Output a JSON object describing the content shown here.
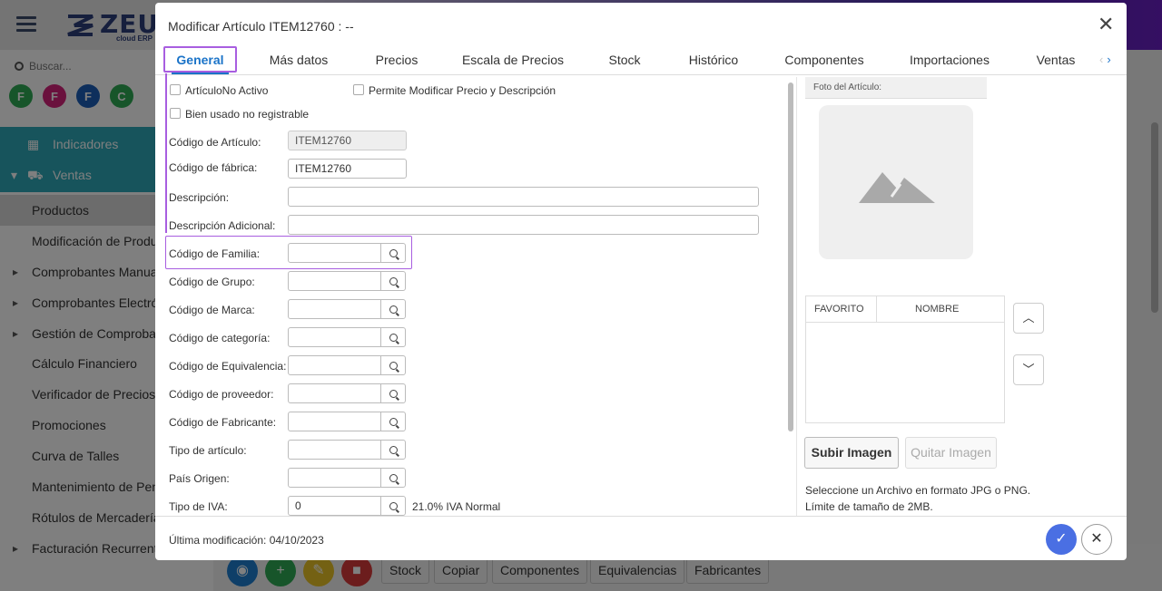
{
  "background": {
    "logo_text": "ZEUS",
    "logo_sub": "cloud ERP",
    "search_placeholder": "Buscar...",
    "avatars": [
      {
        "letter": "F",
        "color": "#2eaa54"
      },
      {
        "letter": "F",
        "color": "#d4237a"
      },
      {
        "letter": "F",
        "color": "#1d5fb8"
      },
      {
        "letter": "C",
        "color": "#2eaa54"
      }
    ],
    "nav": {
      "indicadores": "Indicadores",
      "ventas": "Ventas",
      "items": [
        "Productos",
        "Modificación de Produc",
        "Comprobantes Manuale",
        "Comprobantes Electrón",
        "Gestión de Comprobant",
        "Cálculo Financiero",
        "Verificador de Precios",
        "Promociones",
        "Curva de Talles",
        "Mantenimiento de Penc",
        "Rótulos de Mercadería",
        "Facturación Recurrente"
      ]
    },
    "bottom_buttons": [
      "Stock",
      "Copiar",
      "Componentes",
      "Equivalencias",
      "Fabricantes"
    ]
  },
  "modal": {
    "title": "Modificar Artículo ITEM12760 : --",
    "tabs": [
      "General",
      "Más datos",
      "Precios",
      "Escala de Precios",
      "Stock",
      "Histórico",
      "Componentes",
      "Importaciones",
      "Ventas"
    ],
    "checkboxes": {
      "inactivo": "ArtículoNo Activo",
      "modificar_precio": "Permite Modificar Precio y Descripción",
      "bien_usado": "Bien usado no registrable"
    },
    "fields": {
      "codigo_articulo": {
        "label": "Código de Artículo:",
        "value": "ITEM12760"
      },
      "codigo_fabrica": {
        "label": "Código de fábrica:",
        "value": "ITEM12760"
      },
      "descripcion": {
        "label": "Descripción:",
        "value": ""
      },
      "descripcion_adicional": {
        "label": "Descripción Adicional:",
        "value": ""
      },
      "codigo_familia": {
        "label": "Código de Familia:",
        "value": ""
      },
      "codigo_grupo": {
        "label": "Código de Grupo:",
        "value": ""
      },
      "codigo_marca": {
        "label": "Código de Marca:",
        "value": ""
      },
      "codigo_categoria": {
        "label": "Código de categoría:",
        "value": ""
      },
      "codigo_equivalencia": {
        "label": "Código de Equivalencia:",
        "value": ""
      },
      "codigo_proveedor": {
        "label": "Código de proveedor:",
        "value": ""
      },
      "codigo_fabricante": {
        "label": "Código de Fabricante:",
        "value": ""
      },
      "tipo_articulo": {
        "label": "Tipo de artículo:",
        "value": ""
      },
      "pais_origen": {
        "label": "País Origen:",
        "value": ""
      },
      "tipo_iva": {
        "label": "Tipo de IVA:",
        "value": "0",
        "desc": "21.0% IVA Normal"
      }
    },
    "foto": {
      "header": "Foto del Artículo:",
      "col_favorito": "FAVORITO",
      "col_nombre": "NOMBRE",
      "subir": "Subir Imagen",
      "quitar": "Quitar Imagen",
      "hint1": "Seleccione un Archivo en formato JPG o PNG.",
      "hint2": "Límite de tamaño de 2MB."
    },
    "last_modified": "Última modificación: 04/10/2023"
  }
}
